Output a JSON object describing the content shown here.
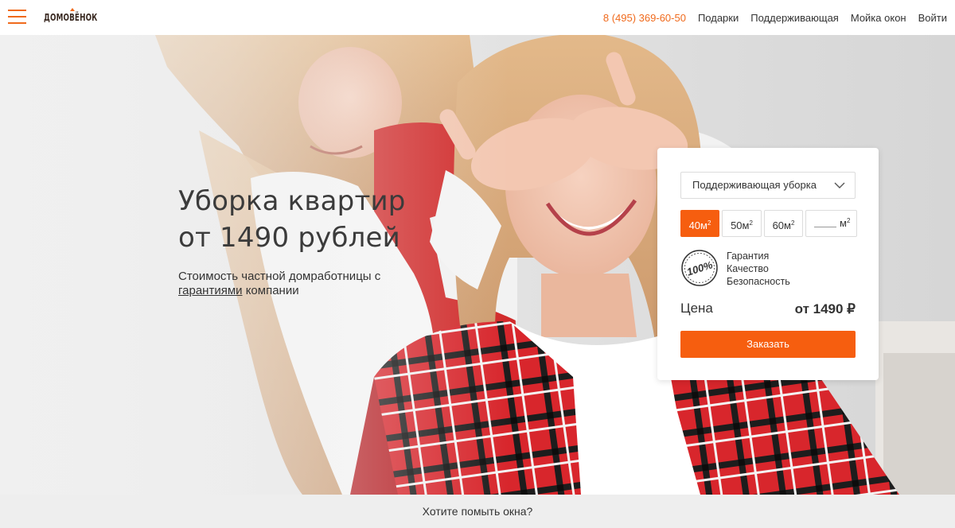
{
  "header": {
    "logo_text": "ДОМОВЁНОК",
    "phone": "8 (495) 369-60-50",
    "nav": [
      "Подарки",
      "Поддерживающая",
      "Мойка окон",
      "Войти"
    ]
  },
  "hero": {
    "title_line1": "Уборка квартир",
    "title_line2": "от 1490 рублей",
    "subtitle_pre": "Стоимость частной домработницы с",
    "subtitle_link": "гарантиями",
    "subtitle_post": "компании"
  },
  "order_form": {
    "service_selected": "Поддерживающая уборка",
    "sizes": [
      {
        "value": "40м",
        "sup": "2",
        "active": true
      },
      {
        "value": "50м",
        "sup": "2",
        "active": false
      },
      {
        "value": "60м",
        "sup": "2",
        "active": false
      }
    ],
    "custom_unit": "м",
    "custom_unit_sup": "2",
    "badge_text": "100%",
    "guarantees": [
      "Гарантия",
      "Качество",
      "Безопасность"
    ],
    "price_label": "Цена",
    "price_value": "от 1490 ₽",
    "order_button": "Заказать"
  },
  "bottom_bar": {
    "text": "Хотите помыть окна?"
  },
  "colors": {
    "accent": "#f65e0f",
    "phone": "#f06a1c",
    "text": "#333333"
  }
}
